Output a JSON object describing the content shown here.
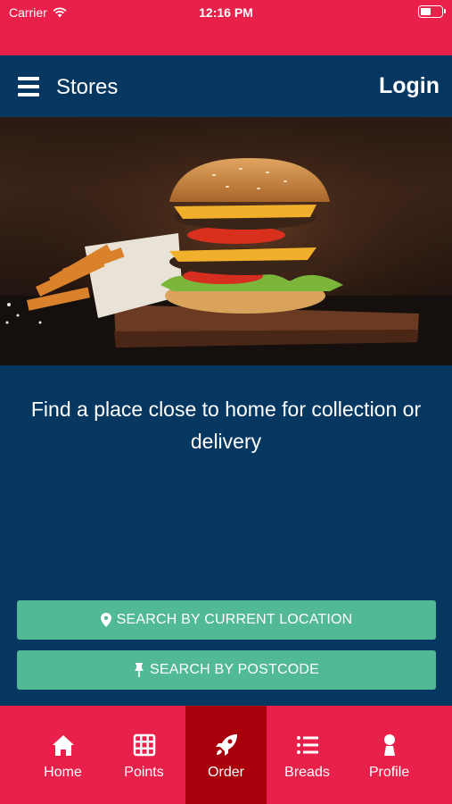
{
  "status_bar": {
    "carrier": "Carrier",
    "time": "12:16 PM",
    "battery_level": 0.5
  },
  "nav": {
    "title": "Stores",
    "login_label": "Login",
    "menu_icon": "hamburger-menu-icon"
  },
  "hero": {
    "image_subject": "burger-with-fries-photo"
  },
  "main": {
    "tagline": "Find a place close to home for collection or delivery",
    "search_location_label": "SEARCH BY CURRENT LOCATION",
    "search_postcode_label": "SEARCH BY POSTCODE",
    "search_location_icon": "map-pin-icon",
    "search_postcode_icon": "push-pin-icon"
  },
  "tabs": [
    {
      "label": "Home",
      "icon": "home-icon",
      "active": false
    },
    {
      "label": "Points",
      "icon": "grid-icon",
      "active": false
    },
    {
      "label": "Order",
      "icon": "rocket-icon",
      "active": true
    },
    {
      "label": "Breads",
      "icon": "list-icon",
      "active": false
    },
    {
      "label": "Profile",
      "icon": "person-icon",
      "active": false
    }
  ],
  "colors": {
    "brand_red": "#e8204a",
    "active_tab": "#a8000a",
    "navy": "#063760",
    "button_green": "#52b996"
  }
}
